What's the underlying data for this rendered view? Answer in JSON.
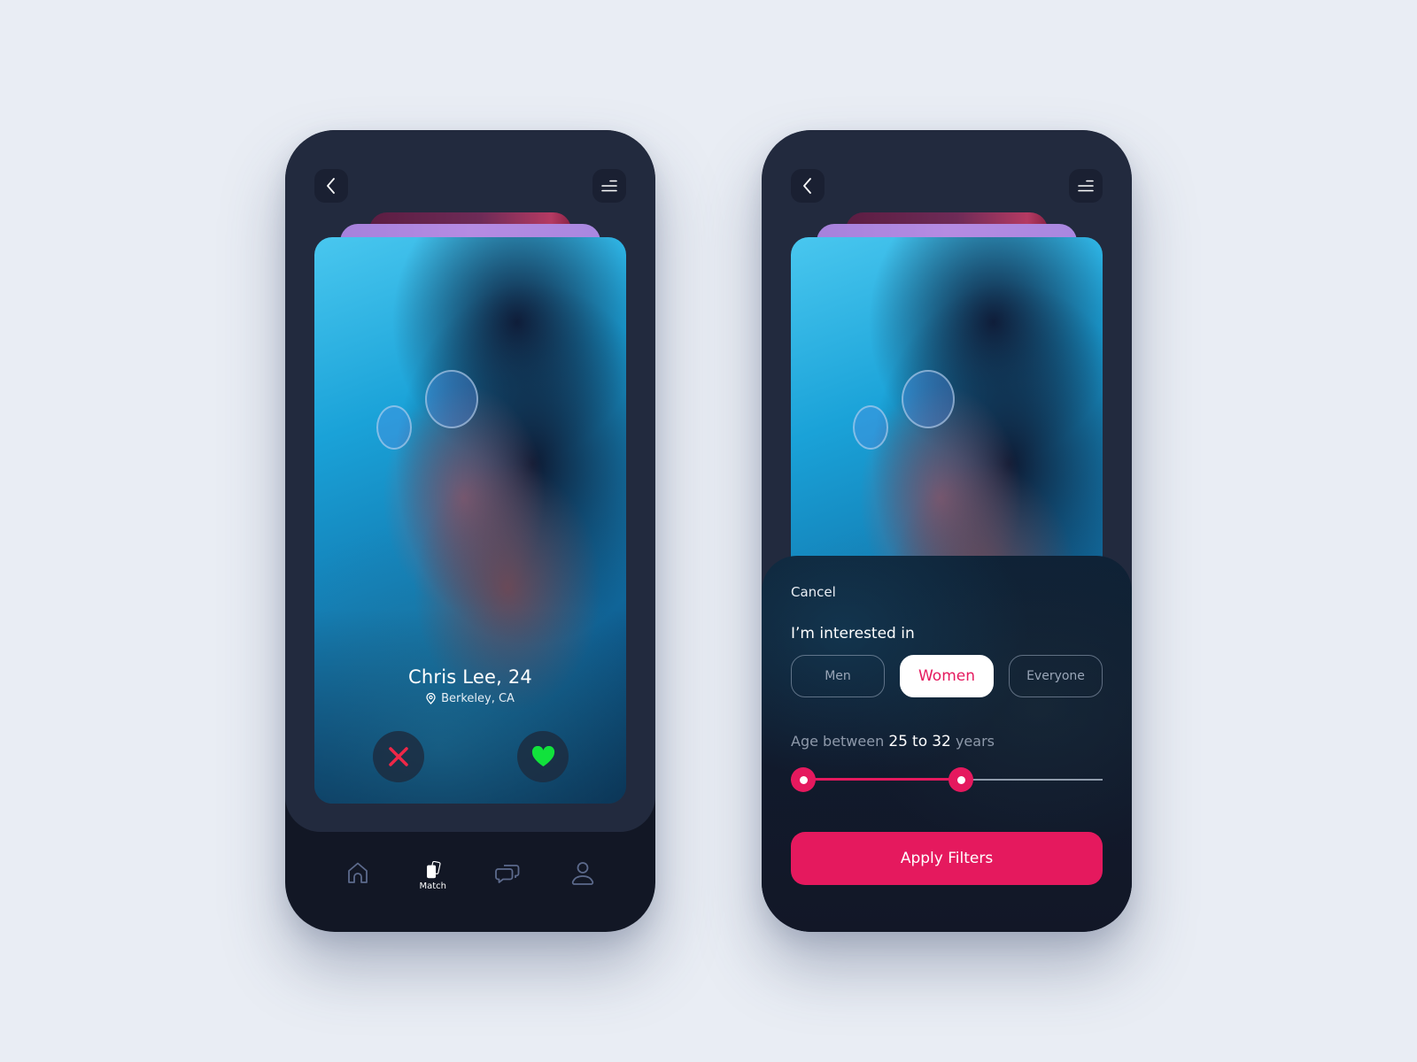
{
  "colors": {
    "background": "#e9edf4",
    "phone_dark": "#121725",
    "phone_panel": "#222a3e",
    "accent": "#e5195e",
    "like_green": "#11e23c",
    "dislike_red": "#ef2747"
  },
  "left_screen": {
    "header": {
      "back_icon": "chevron-left-icon",
      "menu_icon": "menu-lines-icon"
    },
    "profile": {
      "name": "Chris Lee, 24",
      "location": "Berkeley, CA",
      "location_icon": "map-pin-icon"
    },
    "actions": {
      "dislike_icon": "close-x-icon",
      "like_icon": "heart-icon"
    },
    "tabbar": {
      "items": [
        {
          "icon": "home-icon",
          "label": "",
          "active": false
        },
        {
          "icon": "cards-icon",
          "label": "Match",
          "active": true
        },
        {
          "icon": "chat-icon",
          "label": "",
          "active": false
        },
        {
          "icon": "user-icon",
          "label": "",
          "active": false
        }
      ]
    }
  },
  "right_screen": {
    "header": {
      "back_icon": "chevron-left-icon",
      "menu_icon": "menu-lines-icon"
    },
    "filter_sheet": {
      "cancel_label": "Cancel",
      "title": "I’m interested in",
      "options": [
        {
          "label": "Men",
          "selected": false
        },
        {
          "label": "Women",
          "selected": true
        },
        {
          "label": "Everyone",
          "selected": false
        }
      ],
      "age": {
        "prefix": "Age between",
        "min": "25",
        "connector": "to",
        "max": "32",
        "suffix": "years",
        "slider_range_fraction": {
          "low": 0.0,
          "high": 0.55
        }
      },
      "apply_label": "Apply Filters"
    }
  }
}
